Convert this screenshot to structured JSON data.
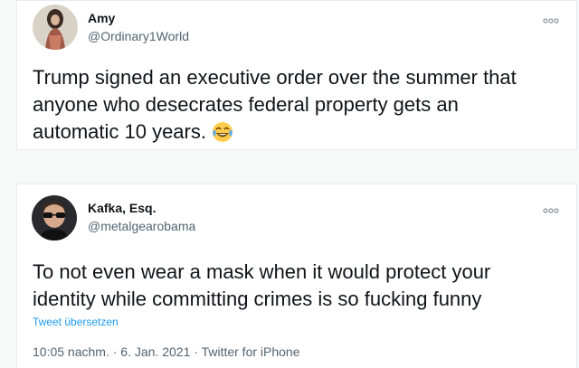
{
  "tweets": [
    {
      "name": "Amy",
      "handle": "@Ordinary1World",
      "text_line1": "Trump signed an executive order over the summer that",
      "text_line2": "anyone who desecrates federal property gets an",
      "text_line3": "automatic 10 years.",
      "emoji": "face-with-tears-of-joy",
      "avatar_icon": "amy-avatar"
    },
    {
      "name": "Kafka, Esq.",
      "handle": "@metalgearobama",
      "text_line1": "To not even wear a mask when it would protect your",
      "text_line2": "identity while committing crimes is so fucking funny",
      "translate_label": "Tweet übersetzen",
      "time": "10:05 nachm.",
      "date": "6. Jan. 2021",
      "source": "Twitter for iPhone",
      "separator": "·",
      "avatar_icon": "kafka-avatar"
    }
  ],
  "more_icon": "more-options-icon",
  "colors": {
    "link": "#1d9bf0",
    "text": "#0f1419",
    "secondary": "#536471",
    "border": "#e6ecf0"
  }
}
